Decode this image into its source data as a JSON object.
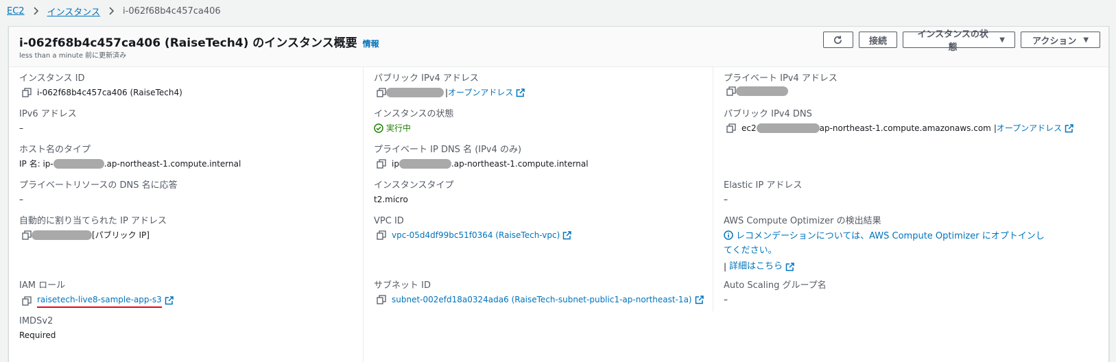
{
  "breadcrumb": {
    "items": [
      "EC2",
      "インスタンス"
    ],
    "current": "i-062f68b4c457ca406"
  },
  "header": {
    "title": "i-062f68b4c457ca406 (RaiseTech4) のインスタンス概要",
    "info": "情報",
    "subtitle": "less than a minute 前に更新済み",
    "connect": "接続",
    "state_menu": "インスタンスの状態",
    "actions_menu": "アクション"
  },
  "col1": {
    "instance_id_label": "インスタンス ID",
    "instance_id_value": "i-062f68b4c457ca406 (RaiseTech4)",
    "ipv6_label": "IPv6 アドレス",
    "ipv6_value": "–",
    "hostname_type_label": "ホスト名のタイプ",
    "hostname_prefix": "IP 名: ip-",
    "hostname_suffix": ".ap-northeast-1.compute.internal",
    "private_dns_answer_label": "プライベートリソースの DNS 名に応答",
    "private_dns_answer_value": "–",
    "auto_ip_label": "自動的に割り当てられた IP アドレス",
    "auto_ip_suffix": "[パブリック IP]",
    "iam_label": "IAM ロール",
    "iam_value": "raisetech-live8-sample-app-s3",
    "imds_label": "IMDSv2",
    "imds_value": "Required"
  },
  "col2": {
    "public_ipv4_label": "パブリック IPv4 アドレス",
    "open_address": "オープンアドレス",
    "state_label": "インスタンスの状態",
    "state_value": "実行中",
    "private_dns_label": "プライベート IP DNS 名 (IPv4 のみ)",
    "private_dns_prefix": "ip",
    "private_dns_suffix": ".ap-northeast-1.compute.internal",
    "type_label": "インスタンスタイプ",
    "type_value": "t2.micro",
    "vpc_label": "VPC ID",
    "vpc_value": "vpc-05d4df99bc51f0364 (RaiseTech-vpc)",
    "subnet_label": "サブネット ID",
    "subnet_value": "subnet-002efd18a0324ada6 (RaiseTech-subnet-public1-ap-northeast-1a)"
  },
  "col3": {
    "private_ipv4_label": "プライベート IPv4 アドレス",
    "public_dns_label": "パブリック IPv4 DNS",
    "public_dns_prefix": "ec2",
    "public_dns_suffix": "ap-northeast-1.compute.amazonaws.com",
    "open_address": "オープンアドレス",
    "elastic_ip_label": "Elastic IP アドレス",
    "elastic_ip_value": "–",
    "optimizer_label": "AWS Compute Optimizer の検出結果",
    "optimizer_text": "レコメンデーションについては、AWS Compute Optimizer にオプトインしてください。",
    "optimizer_details": "詳細はこちら",
    "asg_label": "Auto Scaling グループ名",
    "asg_value": "–"
  },
  "icons": {
    "copy": "copy-icon",
    "external": "external-link-icon",
    "refresh": "refresh-icon",
    "status_ok": "status-ok-icon",
    "info": "info-icon"
  },
  "colors": {
    "link": "#0073bb",
    "running": "#1d8102",
    "highlight_underline": "#e0061a"
  }
}
